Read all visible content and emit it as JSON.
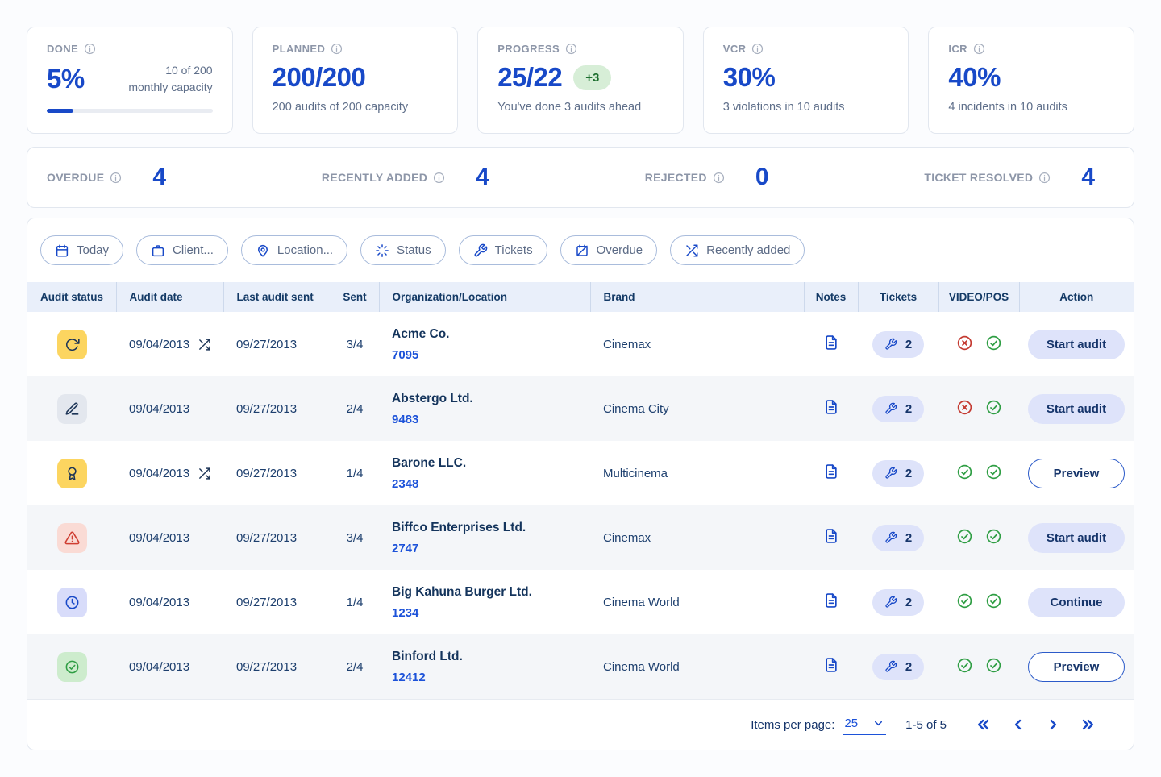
{
  "cards": [
    {
      "label": "DONE",
      "value": "5%",
      "capacity_line1": "10 of 200",
      "capacity_line2": "monthly capacity",
      "progress_pct": 16
    },
    {
      "label": "PLANNED",
      "value": "200/200",
      "sub": "200 audits of 200 capacity"
    },
    {
      "label": "PROGRESS",
      "value": "25/22",
      "badge": "+3",
      "sub": "You've done 3 audits ahead"
    },
    {
      "label": "VCR",
      "value": "30%",
      "sub": "3 violations in 10 audits"
    },
    {
      "label": "ICR",
      "value": "40%",
      "sub": "4 incidents in 10 audits"
    }
  ],
  "summary": {
    "overdue": {
      "label": "OVERDUE",
      "value": "4"
    },
    "recently_added": {
      "label": "RECENTLY ADDED",
      "value": "4"
    },
    "rejected": {
      "label": "REJECTED",
      "value": "0"
    },
    "ticket_resolved": {
      "label": "TICKET RESOLVED",
      "value": "4"
    }
  },
  "filters": [
    {
      "label": "Today",
      "icon": "calendar-icon"
    },
    {
      "label": "Client...",
      "icon": "briefcase-icon"
    },
    {
      "label": "Location...",
      "icon": "location-pin-icon"
    },
    {
      "label": "Status",
      "icon": "spinner-icon"
    },
    {
      "label": "Tickets",
      "icon": "wrench-icon"
    },
    {
      "label": "Overdue",
      "icon": "calendar-crossed-icon"
    },
    {
      "label": "Recently added",
      "icon": "shuffle-icon"
    }
  ],
  "table": {
    "columns": [
      "Audit status",
      "Audit date",
      "Last audit sent",
      "Sent",
      "Organization/Location",
      "Brand",
      "Notes",
      "Tickets",
      "VIDEO/POS",
      "Action"
    ],
    "rows": [
      {
        "status_icon": "refresh-icon",
        "audit_date": "09/04/2013",
        "shuffled": true,
        "last_audit_sent": "09/27/2013",
        "sent": "3/4",
        "organization": "Acme Co.",
        "location_id": "7095",
        "brand": "Cinemax",
        "tickets": "2",
        "video_ok": false,
        "pos_ok": true,
        "action": "Start audit"
      },
      {
        "status_icon": "pen-icon",
        "audit_date": "09/04/2013",
        "shuffled": false,
        "last_audit_sent": "09/27/2013",
        "sent": "2/4",
        "organization": "Abstergo Ltd.",
        "location_id": "9483",
        "brand": "Cinema City",
        "tickets": "2",
        "video_ok": false,
        "pos_ok": true,
        "action": "Start audit"
      },
      {
        "status_icon": "medal-icon",
        "audit_date": "09/04/2013",
        "shuffled": true,
        "last_audit_sent": "09/27/2013",
        "sent": "1/4",
        "organization": "Barone LLC.",
        "location_id": "2348",
        "brand": "Multicinema",
        "tickets": "2",
        "video_ok": true,
        "pos_ok": true,
        "action": "Preview"
      },
      {
        "status_icon": "warning-icon",
        "audit_date": "09/04/2013",
        "shuffled": false,
        "last_audit_sent": "09/27/2013",
        "sent": "3/4",
        "organization": "Biffco Enterprises Ltd.",
        "location_id": "2747",
        "brand": "Cinemax",
        "tickets": "2",
        "video_ok": true,
        "pos_ok": true,
        "action": "Start audit"
      },
      {
        "status_icon": "clock-icon",
        "audit_date": "09/04/2013",
        "shuffled": false,
        "last_audit_sent": "09/27/2013",
        "sent": "1/4",
        "organization": "Big Kahuna Burger Ltd.",
        "location_id": "1234",
        "brand": "Cinema World",
        "tickets": "2",
        "video_ok": true,
        "pos_ok": true,
        "action": "Continue"
      },
      {
        "status_icon": "check-circle-icon",
        "audit_date": "09/04/2013",
        "shuffled": false,
        "last_audit_sent": "09/27/2013",
        "sent": "2/4",
        "organization": "Binford Ltd.",
        "location_id": "12412",
        "brand": "Cinema World",
        "tickets": "2",
        "video_ok": true,
        "pos_ok": true,
        "action": "Preview"
      }
    ]
  },
  "pagination": {
    "items_per_page_label": "Items per page:",
    "items_per_page": "25",
    "range": "1-5 of 5"
  },
  "colors": {
    "primary_blue": "#1849c8",
    "navy_text": "#16386b",
    "green": "#2f9e44",
    "red": "#c43a31",
    "yellow_chip": "#fcd560",
    "lavender_pill": "#dee3fa",
    "badge_green_bg": "#d7eed7",
    "badge_green_text": "#1d6f2f",
    "header_bg": "#e9effa",
    "alt_row_bg": "#f4f6f9"
  }
}
